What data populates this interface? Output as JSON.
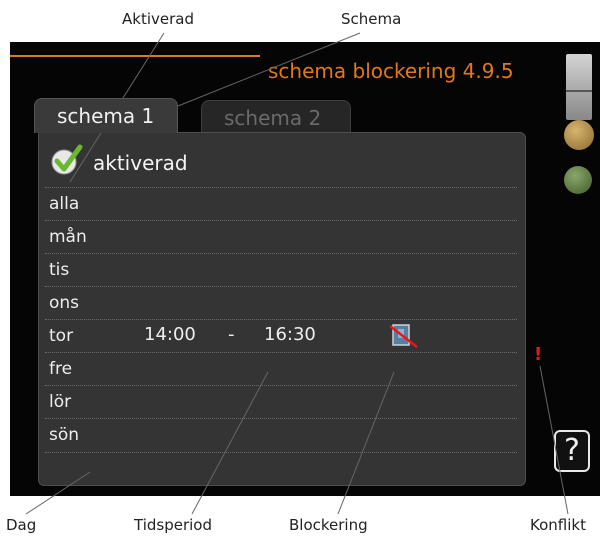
{
  "callouts": {
    "activated": "Aktiverad",
    "schedule": "Schema",
    "day": "Dag",
    "time_period": "Tidsperiod",
    "blocking": "Blockering",
    "conflict": "Konflikt"
  },
  "screen": {
    "title": "schema blockering 4.9.5",
    "tabs": [
      "schema 1",
      "schema 2"
    ],
    "activated_label": "aktiverad",
    "rows": [
      {
        "day": "alla"
      },
      {
        "day": "mån"
      },
      {
        "day": "tis"
      },
      {
        "day": "ons"
      },
      {
        "day": "tor",
        "start": "14:00",
        "dash": "-",
        "end": "16:30",
        "blocked": true,
        "conflict": "!"
      },
      {
        "day": "fre"
      },
      {
        "day": "lör"
      },
      {
        "day": "sön"
      }
    ],
    "help": "?"
  },
  "colors": {
    "accent": "#e0781e",
    "conflict": "#e81818",
    "check": "#6ab82e"
  },
  "icons": [
    "checkmark-icon",
    "block-icon",
    "door-icon",
    "face-icon",
    "clock-icon",
    "help-icon"
  ]
}
